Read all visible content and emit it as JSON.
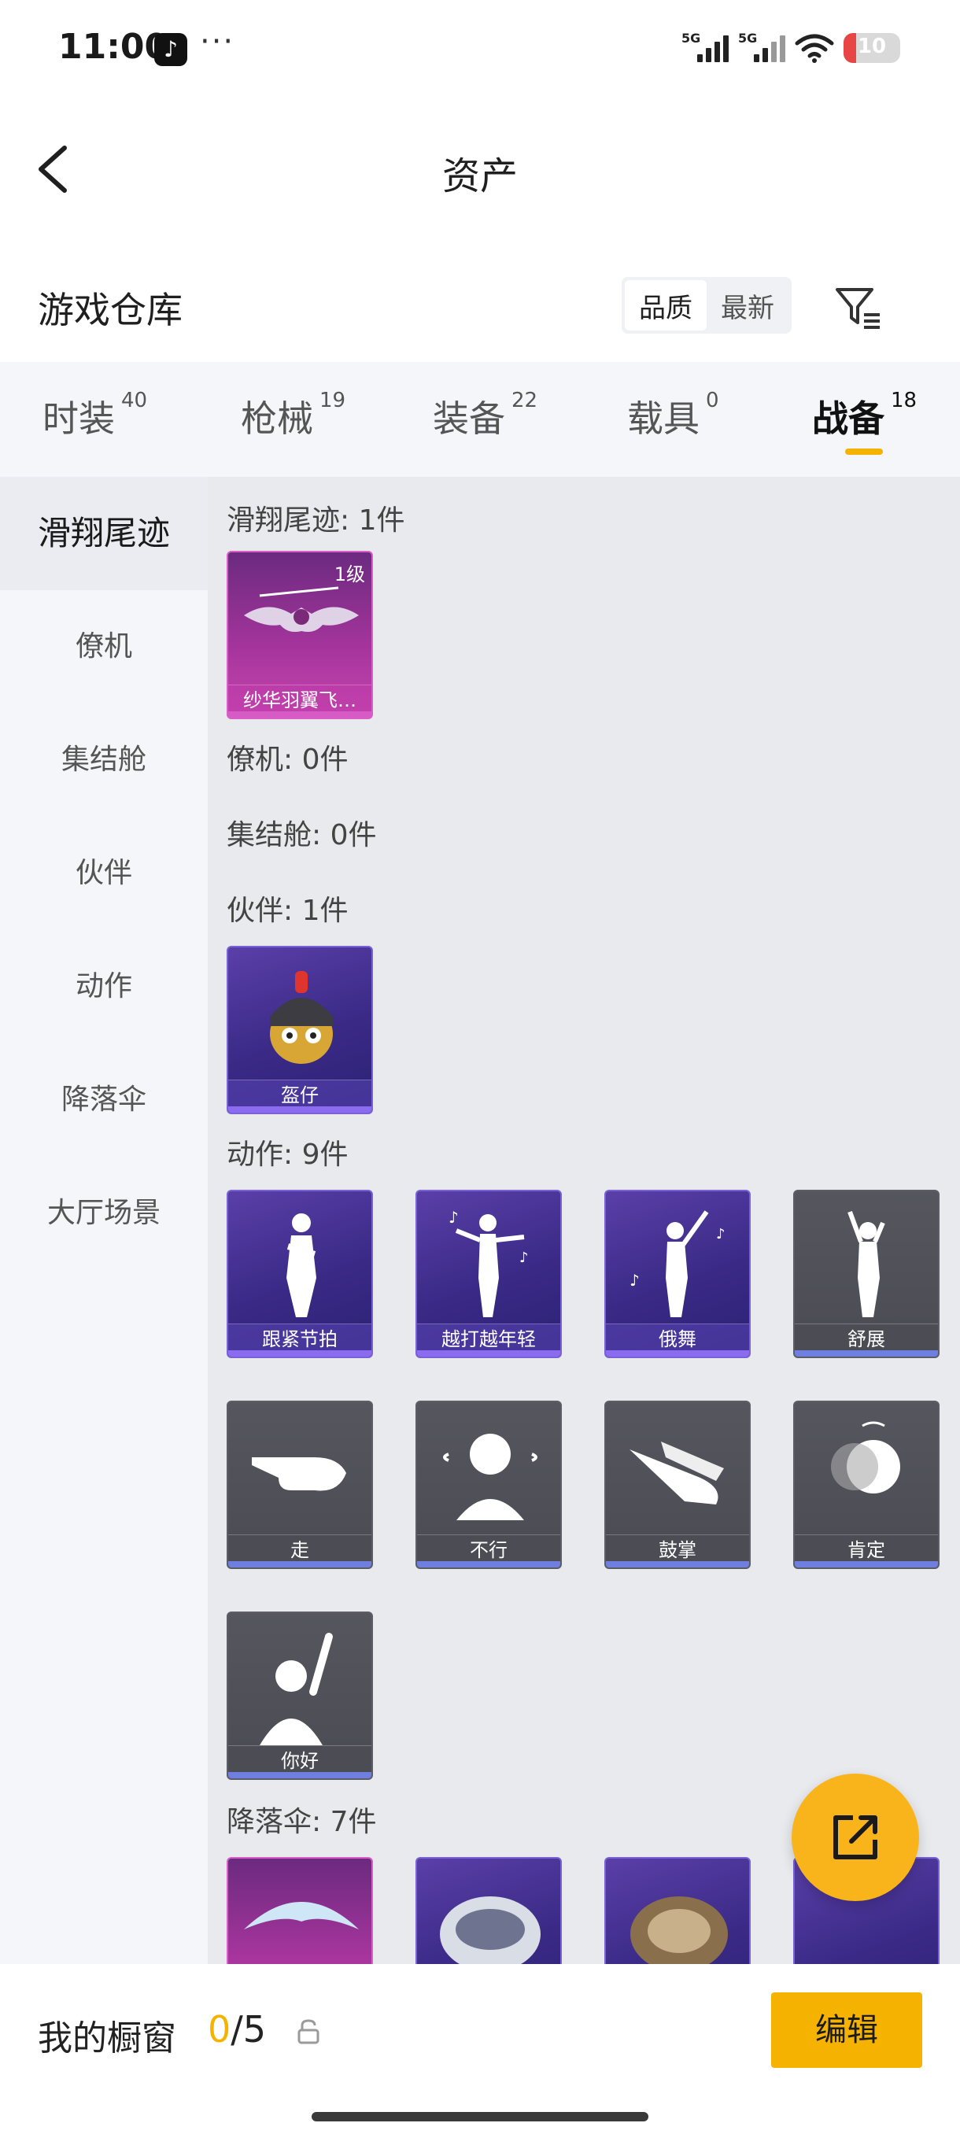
{
  "status_bar": {
    "time": "11:00",
    "app_icon": "tiktok-icon",
    "more": "···",
    "signal1_label": "5G",
    "signal2_label": "5G",
    "battery": "10"
  },
  "nav": {
    "back_icon": "chevron-left-icon",
    "title": "资产"
  },
  "header": {
    "title": "游戏仓库",
    "sort_options": [
      "品质",
      "最新"
    ],
    "sort_active": "品质",
    "filter_icon": "filter-icon"
  },
  "tabs": [
    {
      "label": "时装",
      "count": "40"
    },
    {
      "label": "枪械",
      "count": "19"
    },
    {
      "label": "装备",
      "count": "22"
    },
    {
      "label": "载具",
      "count": "0"
    },
    {
      "label": "战备",
      "count": "18",
      "active": true
    }
  ],
  "sidebar": {
    "items": [
      {
        "label": "滑翔尾迹",
        "active": true
      },
      {
        "label": "僚机"
      },
      {
        "label": "集结舱"
      },
      {
        "label": "伙伴"
      },
      {
        "label": "动作"
      },
      {
        "label": "降落伞"
      },
      {
        "label": "大厅场景"
      }
    ]
  },
  "sections": {
    "glide": {
      "label": "滑翔尾迹: 1件",
      "items": [
        {
          "name": "纱华羽翼飞…",
          "level": "1级",
          "rarity": "magenta"
        }
      ]
    },
    "wingman": {
      "label": "僚机: 0件"
    },
    "pod": {
      "label": "集结舱: 0件"
    },
    "companion": {
      "label": "伙伴: 1件",
      "items": [
        {
          "name": "盔仔",
          "rarity": "purple"
        }
      ]
    },
    "emote": {
      "label": "动作: 9件",
      "items": [
        {
          "name": "跟紧节拍",
          "rarity": "purple"
        },
        {
          "name": "越打越年轻",
          "rarity": "purple"
        },
        {
          "name": "俄舞",
          "rarity": "purple"
        },
        {
          "name": "舒展",
          "rarity": "gray"
        },
        {
          "name": "走",
          "rarity": "gray"
        },
        {
          "name": "不行",
          "rarity": "gray"
        },
        {
          "name": "鼓掌",
          "rarity": "gray"
        },
        {
          "name": "肯定",
          "rarity": "gray"
        },
        {
          "name": "你好",
          "rarity": "gray"
        }
      ]
    },
    "parachute": {
      "label": "降落伞: 7件",
      "items": [
        {
          "rarity": "magenta"
        },
        {
          "rarity": "purple"
        },
        {
          "rarity": "purple"
        },
        {
          "rarity": "purple"
        }
      ]
    }
  },
  "fab": {
    "icon": "share-external-icon"
  },
  "bottom": {
    "label": "我的橱窗",
    "count_current": "0",
    "count_total": "/5",
    "lock_icon": "lock-icon",
    "edit_button": "编辑"
  },
  "colors": {
    "accent": "#f5b300",
    "purple_rarity": "#7862d6",
    "magenta_rarity": "#d85fc6",
    "gray_rarity": "#5c5d66"
  }
}
